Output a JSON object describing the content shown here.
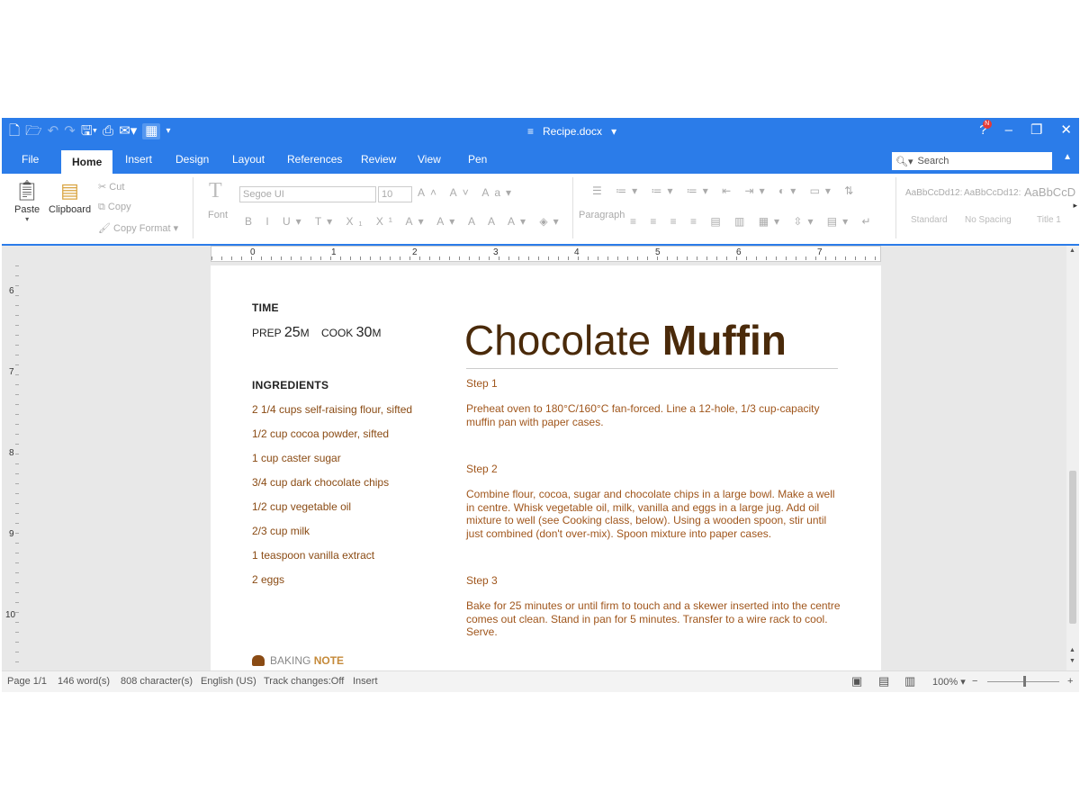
{
  "window": {
    "doc_name": "Recipe.docx",
    "doc_dropdown": "▾",
    "notification_count": "N",
    "minimize": "–",
    "restore": "❐",
    "close": "✕",
    "help": "?"
  },
  "tabs": [
    "File",
    "Home",
    "Insert",
    "Design",
    "Layout",
    "References",
    "Review",
    "View",
    "Pen"
  ],
  "search": {
    "placeholder": "Search"
  },
  "ribbon": {
    "paste": "Paste",
    "clipboard": "Clipboard",
    "cut": "Cut",
    "copy": "Copy",
    "copy_format": "Copy Format",
    "font_group": "Font",
    "font_name": "Segoe UI",
    "font_size": "10",
    "paragraph_group": "Paragraph",
    "styles": [
      {
        "sample": "AaBbCcDd12:",
        "name": "Standard"
      },
      {
        "sample": "AaBbCcDd12:",
        "name": "No Spacing"
      },
      {
        "sample": "AaBbCcD",
        "name": "Title 1"
      }
    ]
  },
  "ruler": {
    "h_numbers": [
      "0",
      "1",
      "2",
      "3",
      "4",
      "5",
      "6",
      "7"
    ],
    "v_numbers": [
      "6",
      "7",
      "8",
      "9",
      "10"
    ]
  },
  "document": {
    "time_label": "TIME",
    "prep_label": "PREP",
    "prep_value": "25",
    "prep_unit": "M",
    "cook_label": "COOK",
    "cook_value": "30",
    "cook_unit": "M",
    "ingredients_label": "INGREDIENTS",
    "ingredients": [
      "2 1/4 cups self-raising flour, sifted",
      "1/2 cup cocoa powder, sifted",
      "1 cup caster sugar",
      "3/4 cup dark chocolate chips",
      "1/2 cup vegetable oil",
      "2/3 cup milk",
      "1 teaspoon vanilla extract",
      "2 eggs"
    ],
    "title_light": "Chocolate ",
    "title_bold": "Muffin",
    "steps": [
      {
        "label": "Step 1",
        "text": "Preheat oven to 180°C/160°C fan-forced. Line a 12-hole, 1/3 cup-capacity muffin pan with paper cases."
      },
      {
        "label": "Step 2",
        "text": "Combine flour, cocoa, sugar and chocolate chips in a large bowl. Make a well in centre. Whisk vegetable oil, milk, vanilla and eggs in a large jug. Add oil mixture to well (see Cooking class, below). Using a wooden spoon, stir until just combined (don't over-mix). Spoon mixture into paper cases."
      },
      {
        "label": "Step 3",
        "text": "Bake for 25 minutes or until firm to touch and a skewer inserted into the centre comes out clean. Stand in pan for 5 minutes. Transfer to a wire rack to cool. Serve."
      }
    ],
    "footer_light": "BAKING ",
    "footer_bold": "NOTE"
  },
  "status": {
    "page": "Page 1/1",
    "words": "146 word(s)",
    "chars": "808 character(s)",
    "language": "English (US)",
    "track": "Track changes:Off",
    "mode": "Insert",
    "zoom": "100%",
    "zoom_minus": "−",
    "zoom_plus": "+"
  }
}
